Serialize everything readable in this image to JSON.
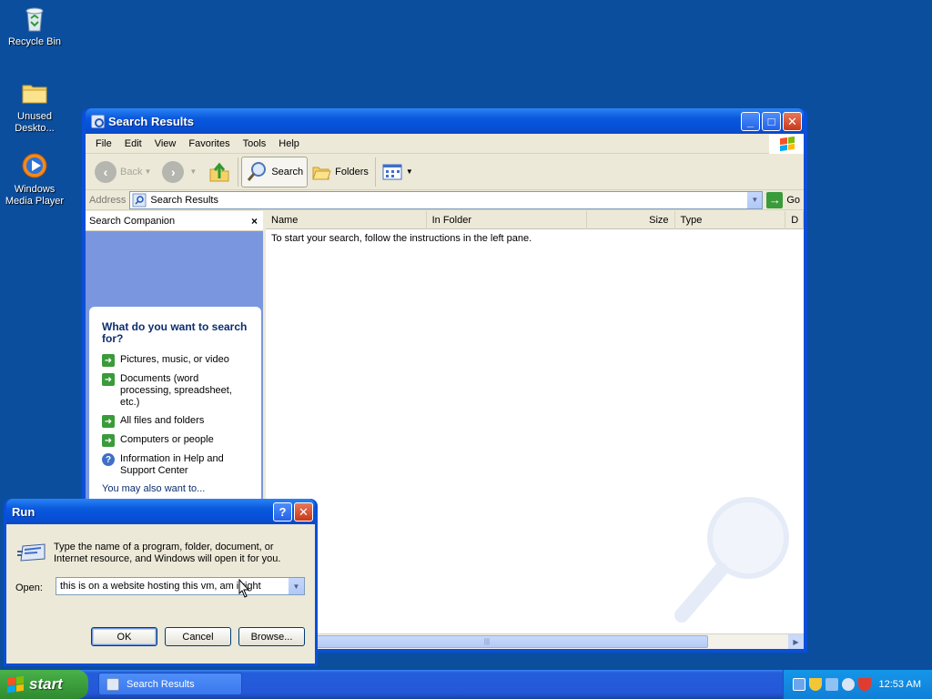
{
  "desktop": {
    "icons": [
      {
        "label": "Recycle Bin",
        "icon": "recycle-bin-icon"
      },
      {
        "label": "Unused Deskto...",
        "icon": "folder-icon"
      },
      {
        "label": "Windows Media Player",
        "icon": "media-player-icon"
      }
    ]
  },
  "explorer": {
    "title": "Search Results",
    "menu": [
      "File",
      "Edit",
      "View",
      "Favorites",
      "Tools",
      "Help"
    ],
    "toolbar": {
      "back": "Back",
      "search": "Search",
      "folders": "Folders"
    },
    "address": {
      "label": "Address",
      "value": "Search Results",
      "go": "Go"
    },
    "companion": {
      "header": "Search Companion",
      "close": "×",
      "question": "What do you want to search for?",
      "options": [
        "Pictures, music, or video",
        "Documents (word processing, spreadsheet, etc.)",
        "All files and folders",
        "Computers or people",
        "Information in Help and Support Center"
      ],
      "more": "You may also want to..."
    },
    "columns": [
      "Name",
      "In Folder",
      "Size",
      "Type",
      "D"
    ],
    "empty_message": "To start your search, follow the instructions in the left pane."
  },
  "run_dialog": {
    "title": "Run",
    "description": "Type the name of a program, folder, document, or Internet resource, and Windows will open it for you.",
    "open_label": "Open:",
    "open_value": "this is on a website hosting this vm, am i right",
    "ok": "OK",
    "cancel": "Cancel",
    "browse": "Browse..."
  },
  "taskbar": {
    "start": "start",
    "task": "Search Results",
    "clock": "12:53 AM"
  },
  "colors": {
    "desktop": "#0b4e9e",
    "title_blue": "#0a58dc",
    "companion_blue": "#7a96df",
    "start_green": "#3c9e3c"
  }
}
